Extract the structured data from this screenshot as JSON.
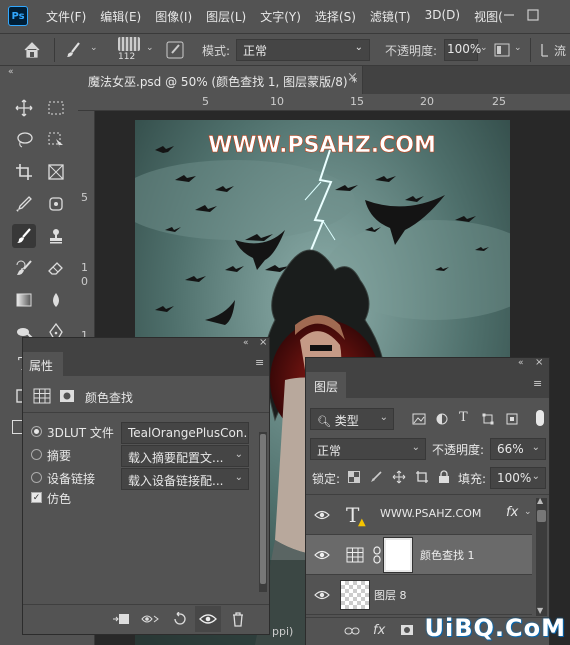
{
  "menubar": {
    "logo": "Ps",
    "items": [
      "文件(F)",
      "编辑(E)",
      "图像(I)",
      "图层(L)",
      "文字(Y)",
      "选择(S)",
      "滤镜(T)",
      "3D(D)",
      "视图("
    ]
  },
  "options_bar": {
    "brush_size": "112",
    "mode_label": "模式:",
    "mode_value": "正常",
    "opacity_label": "不透明度:",
    "opacity_value": "100%",
    "flow_label": "流"
  },
  "document_tab": {
    "title": "魔法女巫.psd @ 50% (颜色查找 1, 图层蒙版/8) *",
    "close": "×"
  },
  "rulers": {
    "top": [
      "5",
      "10",
      "15",
      "20",
      "25"
    ],
    "left": [
      "5",
      "1",
      "1",
      "0"
    ]
  },
  "artwork": {
    "watermark_text": "WWW.PSAHZ.COM"
  },
  "properties_panel": {
    "tab": "属性",
    "adjustment_name": "颜色查找",
    "options": [
      {
        "label": "3DLUT 文件",
        "value": "TealOrangePlusCon...",
        "selected": true
      },
      {
        "label": "摘要",
        "value": "载入摘要配置文...",
        "selected": false
      },
      {
        "label": "设备链接",
        "value": "载入设备链接配...",
        "selected": false
      }
    ],
    "dither_label": "仿色",
    "dither_checked": true
  },
  "layers_panel": {
    "tab": "图层",
    "filter_kind": "类型",
    "blend_mode": "正常",
    "opacity_label": "不透明度:",
    "opacity_value": "66%",
    "lock_label": "锁定:",
    "fill_label": "填充:",
    "fill_value": "100%",
    "layers": [
      {
        "name": "WWW.PSAHZ.COM",
        "kind": "text",
        "fx": "fx"
      },
      {
        "name": "颜色查找 1",
        "kind": "adjustment",
        "selected": true
      },
      {
        "name": "图层 8",
        "kind": "pixel"
      }
    ]
  },
  "status": {
    "partial_text": "ppi)"
  },
  "site_watermark": "UiBQ.CoM",
  "colors": {
    "ui_bg": "#535353",
    "panel_header": "#424242",
    "canvas_bg": "#282828",
    "selected_row": "#6a6a6a",
    "watermark_blue": "#0a61a6"
  }
}
